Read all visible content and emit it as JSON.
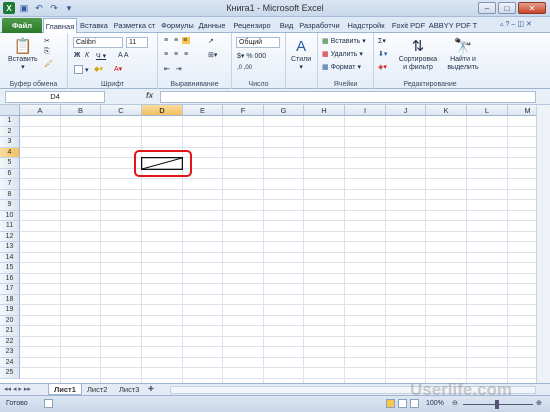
{
  "window": {
    "title": "Книга1 - Microsoft Excel"
  },
  "tabs": [
    "Файл",
    "Главная",
    "Вставка",
    "Разметка ст",
    "Формулы",
    "Данные",
    "Рецензиро",
    "Вид",
    "Разработчи",
    "Надстройк",
    "Foxit PDF",
    "ABBYY PDF T"
  ],
  "ribbon": {
    "clipboard": {
      "paste": "Вставить",
      "label": "Буфер обмена"
    },
    "font": {
      "name": "Calibri",
      "size": "11",
      "label": "Шрифт"
    },
    "alignment": {
      "label": "Выравнивание"
    },
    "number": {
      "format": "Общий",
      "label": "Число"
    },
    "styles": {
      "button": "Стили"
    },
    "cells": {
      "insert": "Вставить",
      "delete": "Удалить",
      "format": "Формат",
      "label": "Ячейки"
    },
    "editing": {
      "sort": "Сортировка и фильтр",
      "find": "Найти и выделить",
      "label": "Редактирование"
    }
  },
  "formula_bar": {
    "cell": "D4",
    "fx": "fx",
    "value": ""
  },
  "columns": [
    "A",
    "B",
    "C",
    "D",
    "E",
    "F",
    "G",
    "H",
    "I",
    "J",
    "K",
    "L",
    "M"
  ],
  "rows": [
    "1",
    "2",
    "3",
    "4",
    "5",
    "6",
    "7",
    "8",
    "9",
    "10",
    "11",
    "12",
    "13",
    "14",
    "15",
    "16",
    "17",
    "18",
    "19",
    "20",
    "21",
    "22",
    "23",
    "24",
    "25"
  ],
  "sheets": [
    "Лист1",
    "Лист2",
    "Лист3"
  ],
  "status": {
    "ready": "Готово",
    "zoom": "100%"
  },
  "watermark": "Userlife.com"
}
